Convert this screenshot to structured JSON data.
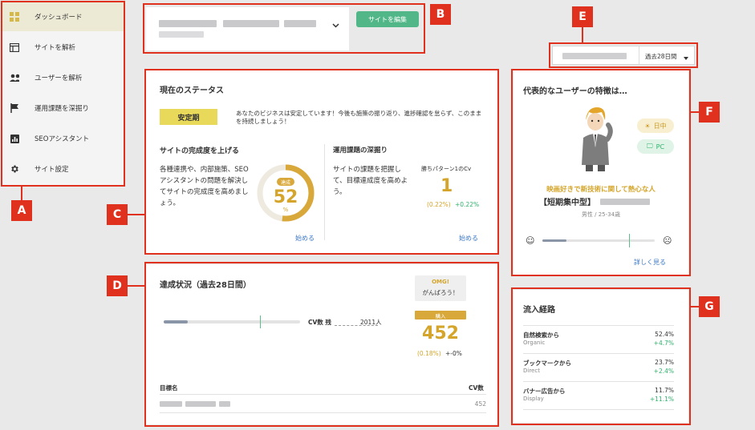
{
  "sidebar": {
    "items": [
      {
        "label": "ダッシュボード",
        "icon": "dashboard-icon"
      },
      {
        "label": "サイトを解析",
        "icon": "site-analysis-icon"
      },
      {
        "label": "ユーザーを解析",
        "icon": "users-icon"
      },
      {
        "label": "運用課題を深掘り",
        "icon": "flag-icon"
      },
      {
        "label": "SEOアシスタント",
        "icon": "bar-chart-icon"
      },
      {
        "label": "サイト設定",
        "icon": "gear-icon"
      }
    ]
  },
  "header": {
    "edit_site_label": "サイトを編集"
  },
  "date_range": {
    "selected": "過去28日間"
  },
  "status": {
    "title": "現在のステータス",
    "badge": "安定期",
    "message": "あなたのビジネスは安定しています！今後も施策の振り返り、進捗確認を怠らず、このままを持続しましょう！",
    "left": {
      "heading": "サイトの完成度を上げる",
      "desc": "各種連携や、内部施策、SEOアシスタントの問題を解決してサイトの完成度を高めましょう。",
      "gauge_label": "達成",
      "gauge_value": "52",
      "gauge_unit": "%",
      "gauge_fraction": 0.52,
      "link": "始める"
    },
    "right": {
      "heading": "運用課題の深掘り",
      "desc": "サイトの課題を把握して、目標達成度を高めよう。",
      "pattern_label": "勝ちパターン1のCv",
      "pattern_value": "1",
      "pattern_rate": "(0.22%)",
      "pattern_change": "+0.22%",
      "link": "始める"
    }
  },
  "progress": {
    "title": "達成状況（過去28日間）",
    "bubble_top": "OMG!",
    "bubble_bottom": "がんばろう！",
    "cv_label": "CV数 残",
    "cv_remaining": "2011人",
    "badge": "購入",
    "value": "452",
    "rate": "(0.18%)",
    "change": "+-0%",
    "col_goal": "目標名",
    "col_cv": "CV数",
    "row_cv": "452"
  },
  "user": {
    "title": "代表的なユーザーの特徴は…",
    "time_tag": "日中",
    "device_tag": "PC",
    "interest": "映画好きで新技術に関して熱心な人",
    "type": "【短期集中型】",
    "demographic": "男性 / 25-34歳",
    "link": "詳しく見る"
  },
  "traffic": {
    "title": "流入経路",
    "rows": [
      {
        "name": "自然検索から",
        "sub": "Organic",
        "pct": "52.4%",
        "change": "+4.7%"
      },
      {
        "name": "ブックマークから",
        "sub": "Direct",
        "pct": "23.7%",
        "change": "+2.4%"
      },
      {
        "name": "バナー広告から",
        "sub": "Display",
        "pct": "11.7%",
        "change": "+11.1%"
      }
    ]
  },
  "annotations": [
    "A",
    "B",
    "C",
    "D",
    "E",
    "F",
    "G"
  ],
  "colors": {
    "accent_green": "#52b788",
    "gold": "#d4a52a",
    "annotation_red": "#e0311f",
    "positive": "#2db36a"
  }
}
